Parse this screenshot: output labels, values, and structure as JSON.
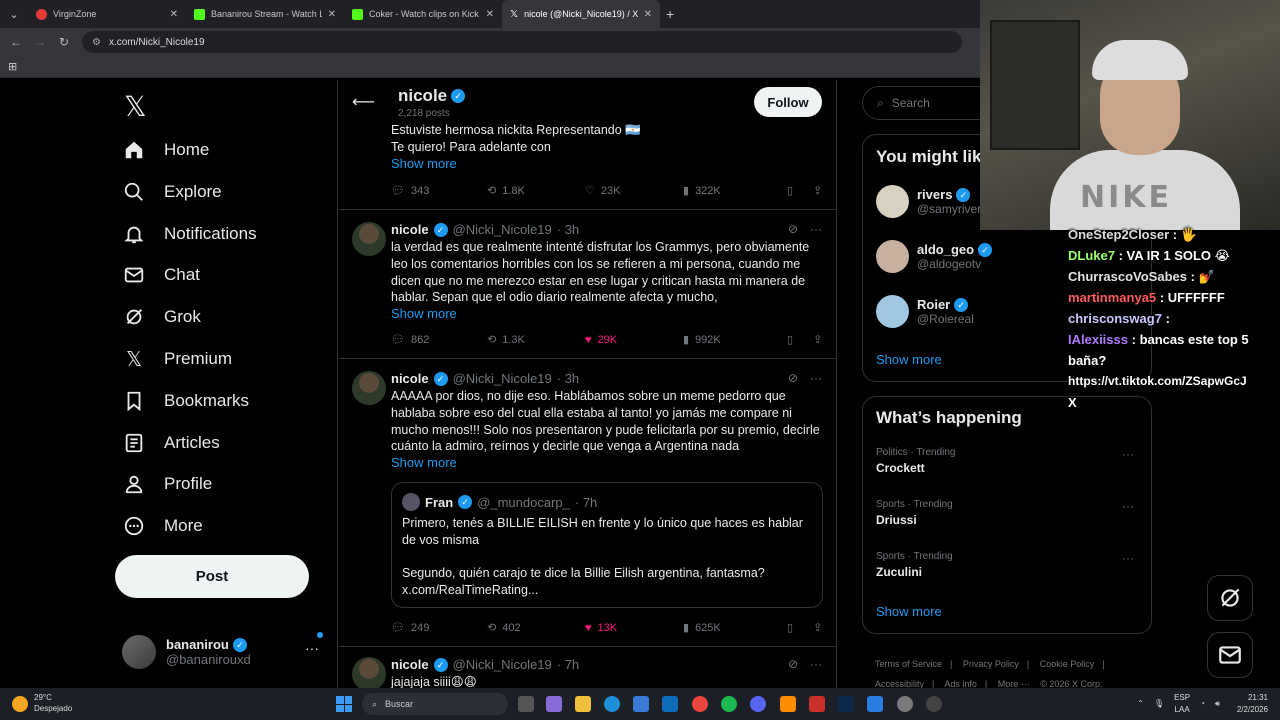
{
  "browser": {
    "tabs": [
      {
        "title": "VirginZone",
        "color": "#e53935"
      },
      {
        "title": "Bananirou Stream - Watch Live",
        "color": "#53fc18"
      },
      {
        "title": "Coker - Watch clips on Kick",
        "color": "#53fc18"
      },
      {
        "title": "nicole (@Nicki_Nicole19) / X",
        "color": "#ffffff"
      }
    ],
    "url": "x.com/Nicki_Nicole19"
  },
  "nav": {
    "items": [
      "Home",
      "Explore",
      "Notifications",
      "Chat",
      "Grok",
      "Premium",
      "Bookmarks",
      "Articles",
      "Profile",
      "More"
    ],
    "post_label": "Post",
    "account_name": "bananirou",
    "account_handle": "@bananirouxd"
  },
  "profile": {
    "name": "nicole",
    "posts": "2,218 posts",
    "follow_label": "Follow"
  },
  "tweets": [
    {
      "text": "Estuviste hermosa nickita Representando 🇦🇷\nTe quiero! Para adelante con",
      "show_more": "Show more",
      "replies": "343",
      "retweets": "1.8K",
      "likes": "23K",
      "views": "322K",
      "liked": false
    },
    {
      "name": "nicole",
      "handle": "@Nicki_Nicole19",
      "time": "· 3h",
      "text": "la verdad es que realmente intenté disfrutar los Grammys, pero obviamente leo los comentarios horribles con los se refieren a mi persona, cuando me dicen que no me merezco estar en ese lugar y critican hasta mi manera de hablar. Sepan que el odio diario realmente afecta y mucho,",
      "show_more": "Show more",
      "replies": "862",
      "retweets": "1.3K",
      "likes": "29K",
      "views": "992K",
      "liked": true
    },
    {
      "name": "nicole",
      "handle": "@Nicki_Nicole19",
      "time": "· 3h",
      "text": "AAAAA por dios, no dije eso. Hablábamos sobre un meme pedorro que hablaba sobre eso del cual ella estaba al tanto! yo jamás me compare ni mucho menos!!! Solo nos presentaron y pude felicitarla por su premio, decirle cuánto la admiro, reírnos y decirle que venga a Argentina nada",
      "show_more": "Show more",
      "quote": {
        "name": "Fran",
        "handle": "@_mundocarp_",
        "time": "· 7h",
        "text": "Primero, tenés a BILLIE EILISH en frente y lo único que haces es hablar de vos misma\n\nSegundo, quién carajo te dice la Billie Eilish argentina, fantasma?\nx.com/RealTimeRating..."
      },
      "replies": "249",
      "retweets": "402",
      "likes": "13K",
      "views": "625K",
      "liked": true
    },
    {
      "name": "nicole",
      "handle": "@Nicki_Nicole19",
      "time": "· 7h",
      "text": "jajajaja siiii😩😩"
    }
  ],
  "right": {
    "search_placeholder": "Search",
    "who_title": "You might lik",
    "who": [
      {
        "name": "rivers",
        "handle": "@samyriver",
        "color": "#d8d0c0"
      },
      {
        "name": "aldo_geo",
        "handle": "@aldogeotv",
        "color": "#c8b0a0"
      },
      {
        "name": "Roier",
        "handle": "@Roiereal",
        "color": "#a0c8e0"
      }
    ],
    "show_more": "Show more",
    "trends_title": "What’s happening",
    "trends": [
      {
        "category": "Politics · Trending",
        "topic": "Crockett"
      },
      {
        "category": "Sports · Trending",
        "topic": "Driussi"
      },
      {
        "category": "Sports · Trending",
        "topic": "Zuculini"
      }
    ],
    "trends_more": "Show more",
    "footer": [
      "Terms of Service",
      "|",
      "Privacy Policy",
      "|",
      "Cookie Policy",
      "|",
      "Accessibility",
      "|",
      "Ads info",
      "|",
      "More ···",
      "© 2026 X Corp."
    ]
  },
  "stream": {
    "shirt_text": "NIKE",
    "chat": [
      {
        "user": "OneStep2Closer",
        "msg": ": 🖐",
        "cls": "u1"
      },
      {
        "user": "DLuke7",
        "msg": ": VA IR 1 SOLO 😭",
        "cls": "u2"
      },
      {
        "user": "ChurrascoVoSabes",
        "msg": ": 💅",
        "cls": "u3"
      },
      {
        "user": "martinmanya5",
        "msg": ": UFFFFFF",
        "cls": "u4"
      },
      {
        "user": "chrisconswag7",
        "msg": ":",
        "cls": "u5"
      },
      {
        "user": "IAlexiisss",
        "msg": ": bancas este top 5",
        "cls": "u6"
      },
      {
        "user": "",
        "msg": "baña?",
        "cls": "u1"
      },
      {
        "user": "",
        "msg": "https://vt.tiktok.com/ZSapwGcJ",
        "cls": "u1"
      },
      {
        "user": "",
        "msg": "X",
        "cls": "u1"
      }
    ]
  },
  "taskbar": {
    "temp": "29°C",
    "weather": "Despejado",
    "search": "Buscar",
    "lang1": "ESP",
    "lang2": "LAA",
    "time": "21:31",
    "date": "2/2/2026"
  }
}
